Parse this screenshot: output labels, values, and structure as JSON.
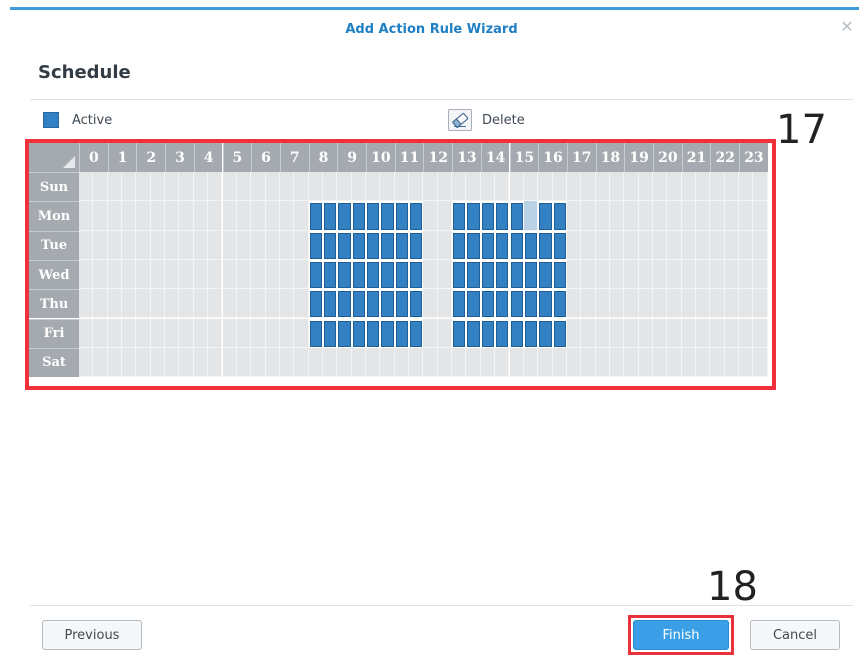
{
  "dialog": {
    "title": "Add Action Rule Wizard",
    "close_icon": "close-icon"
  },
  "page": {
    "heading": "Schedule"
  },
  "modes": {
    "active_label": "Active",
    "delete_label": "Delete",
    "active_color": "#3380c2"
  },
  "schedule": {
    "hours": [
      "0",
      "1",
      "2",
      "3",
      "4",
      "5",
      "6",
      "7",
      "8",
      "9",
      "10",
      "11",
      "12",
      "13",
      "14",
      "15",
      "16",
      "17",
      "18",
      "19",
      "20",
      "21",
      "22",
      "23"
    ],
    "days": [
      "Sun",
      "Mon",
      "Tue",
      "Wed",
      "Thu",
      "Fri",
      "Sat"
    ],
    "active_hours": {
      "Sun": [],
      "Mon": [
        8,
        9,
        10,
        11,
        13,
        14,
        15,
        16
      ],
      "Tue": [
        8,
        9,
        10,
        11,
        13,
        14,
        15,
        16
      ],
      "Wed": [
        8,
        9,
        10,
        11,
        13,
        14,
        15,
        16
      ],
      "Thu": [
        8,
        9,
        10,
        11,
        13,
        14,
        15,
        16
      ],
      "Fri": [
        8,
        9,
        10,
        11,
        13,
        14,
        15,
        16
      ],
      "Sat": []
    },
    "highlighted_slots": [
      {
        "day": "Mon",
        "hour": 15,
        "half": 1
      }
    ]
  },
  "callouts": {
    "grid": "17",
    "finish": "18"
  },
  "footer": {
    "previous_label": "Previous",
    "finish_label": "Finish",
    "cancel_label": "Cancel"
  }
}
